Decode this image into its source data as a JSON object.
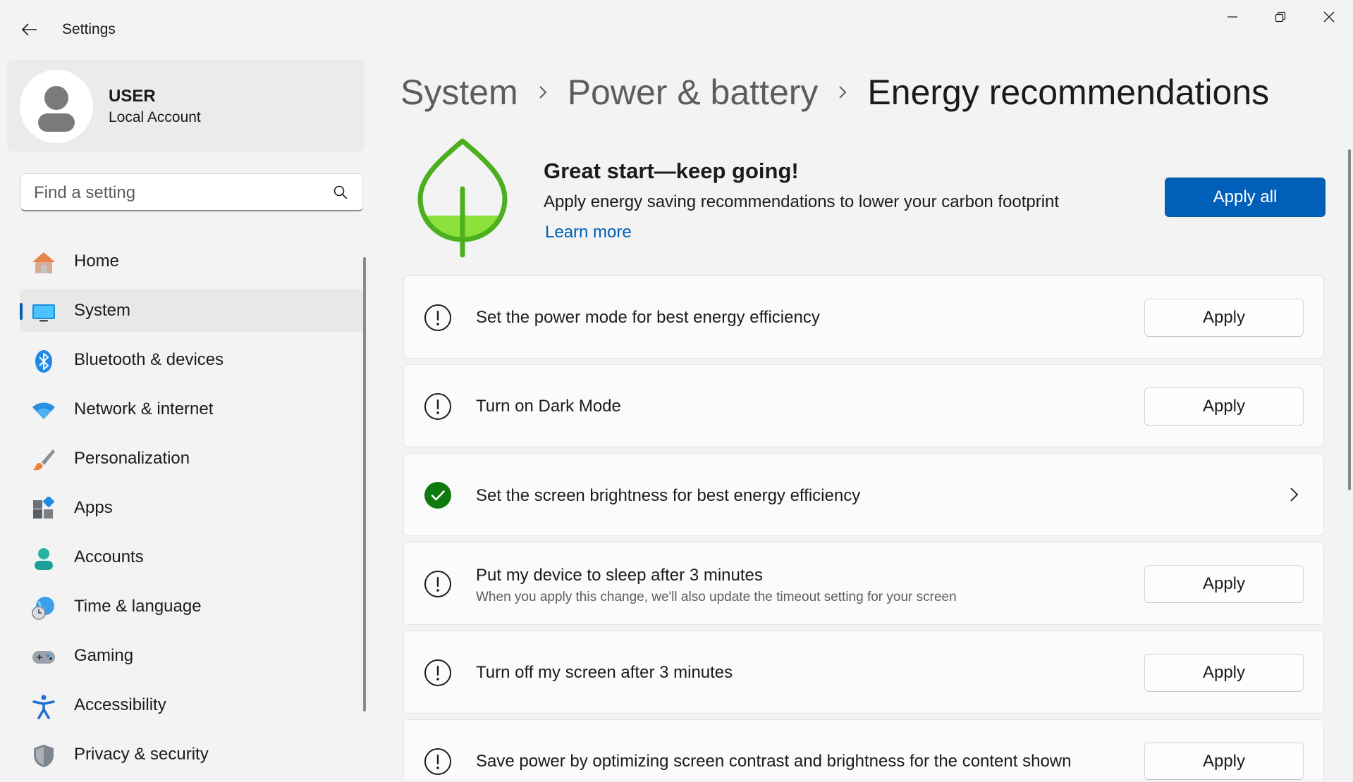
{
  "window": {
    "title": "Settings"
  },
  "profile": {
    "name": "USER",
    "account_type": "Local Account"
  },
  "search": {
    "placeholder": "Find a setting"
  },
  "nav": [
    {
      "label": "Home",
      "icon": "home-icon"
    },
    {
      "label": "System",
      "icon": "system-icon",
      "selected": true
    },
    {
      "label": "Bluetooth & devices",
      "icon": "bluetooth-icon"
    },
    {
      "label": "Network & internet",
      "icon": "wifi-icon"
    },
    {
      "label": "Personalization",
      "icon": "paintbrush-icon"
    },
    {
      "label": "Apps",
      "icon": "apps-icon"
    },
    {
      "label": "Accounts",
      "icon": "accounts-icon"
    },
    {
      "label": "Time & language",
      "icon": "globe-clock-icon"
    },
    {
      "label": "Gaming",
      "icon": "gamepad-icon"
    },
    {
      "label": "Accessibility",
      "icon": "accessibility-icon"
    },
    {
      "label": "Privacy & security",
      "icon": "shield-icon"
    }
  ],
  "breadcrumb": [
    "System",
    "Power & battery",
    "Energy recommendations"
  ],
  "hero": {
    "title": "Great start—keep going!",
    "subtitle": "Apply energy saving recommendations to lower your carbon footprint",
    "link": "Learn more",
    "button": "Apply all"
  },
  "recommendations": [
    {
      "title": "Set the power mode for best energy efficiency",
      "status": "pending",
      "action": "Apply"
    },
    {
      "title": "Turn on Dark Mode",
      "status": "pending",
      "action": "Apply"
    },
    {
      "title": "Set the screen brightness for best energy efficiency",
      "status": "done"
    },
    {
      "title": "Put my device to sleep after 3 minutes",
      "description": "When you apply this change, we'll also update the timeout setting for your screen",
      "status": "pending",
      "action": "Apply"
    },
    {
      "title": "Turn off my screen after 3 minutes",
      "status": "pending",
      "action": "Apply"
    },
    {
      "title": "Save power by optimizing screen contrast and brightness for the content shown",
      "status": "pending",
      "action": "Apply"
    }
  ],
  "colors": {
    "accent": "#005fb8",
    "success": "#0f7b0f",
    "leaf": "#4caf1e",
    "background": "#f3f3f3"
  }
}
